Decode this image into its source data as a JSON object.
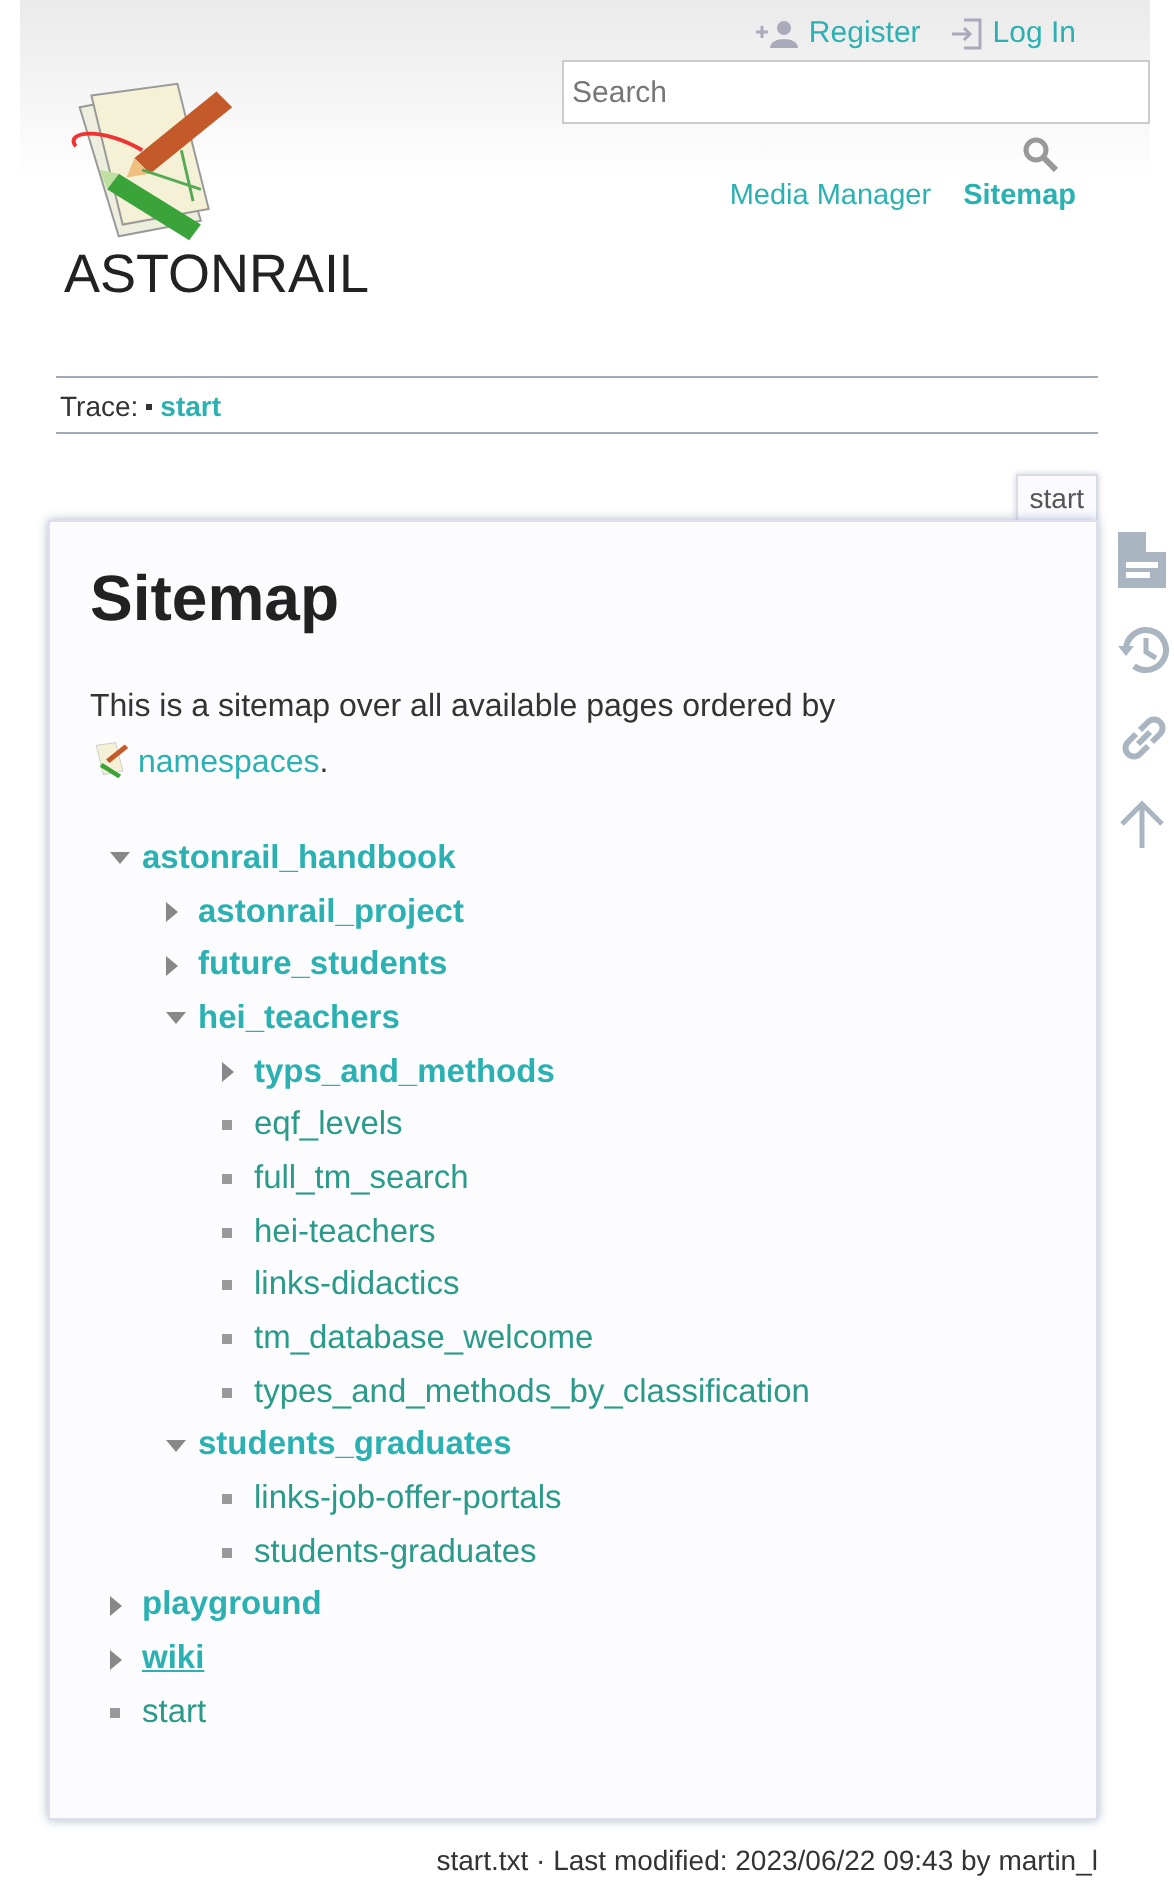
{
  "user_tools": [
    {
      "kind": "register",
      "label": "Register"
    },
    {
      "kind": "login",
      "label": "Log In"
    }
  ],
  "search": {
    "placeholder": "Search"
  },
  "site": {
    "title": "ASTONRAIL"
  },
  "site_tools": [
    {
      "label": "Media Manager",
      "selected": false
    },
    {
      "label": "Sitemap",
      "selected": true
    }
  ],
  "breadcrumbs": {
    "label": "Trace:",
    "items": [
      "start"
    ]
  },
  "page_tab": "start",
  "page": {
    "heading": "Sitemap",
    "intro": "This is a sitemap over all available pages ordered by",
    "intro_link": "namespaces",
    "intro_end": ".",
    "tree": [
      {
        "kind": "namespace",
        "name": "astonrail_handbook",
        "expanded": true,
        "hovered": false,
        "children": [
          {
            "kind": "namespace",
            "name": "astonrail_project",
            "expanded": false,
            "hovered": false
          },
          {
            "kind": "namespace",
            "name": "future_students",
            "expanded": false,
            "hovered": false
          },
          {
            "kind": "namespace",
            "name": "hei_teachers",
            "expanded": true,
            "hovered": false,
            "children": [
              {
                "kind": "namespace",
                "name": "typs_and_methods",
                "expanded": false,
                "hovered": false
              },
              {
                "kind": "page",
                "name": "eqf_levels"
              },
              {
                "kind": "page",
                "name": "full_tm_search"
              },
              {
                "kind": "page",
                "name": "hei-teachers"
              },
              {
                "kind": "page",
                "name": "links-didactics"
              },
              {
                "kind": "page",
                "name": "tm_database_welcome"
              },
              {
                "kind": "page",
                "name": "types_and_methods_by_classification"
              }
            ]
          },
          {
            "kind": "namespace",
            "name": "students_graduates",
            "expanded": true,
            "hovered": false,
            "children": [
              {
                "kind": "page",
                "name": "links-job-offer-portals"
              },
              {
                "kind": "page",
                "name": "students-graduates"
              }
            ]
          }
        ]
      },
      {
        "kind": "namespace",
        "name": "playground",
        "expanded": false,
        "hovered": false
      },
      {
        "kind": "namespace",
        "name": "wiki",
        "expanded": false,
        "hovered": true
      },
      {
        "kind": "page",
        "name": "start"
      }
    ]
  },
  "page_tools": [
    {
      "kind": "page"
    },
    {
      "kind": "revisions"
    },
    {
      "kind": "backlinks"
    },
    {
      "kind": "top"
    }
  ],
  "doc_info": "start.txt · Last modified: 2023/06/22 09:43 by martin_l"
}
